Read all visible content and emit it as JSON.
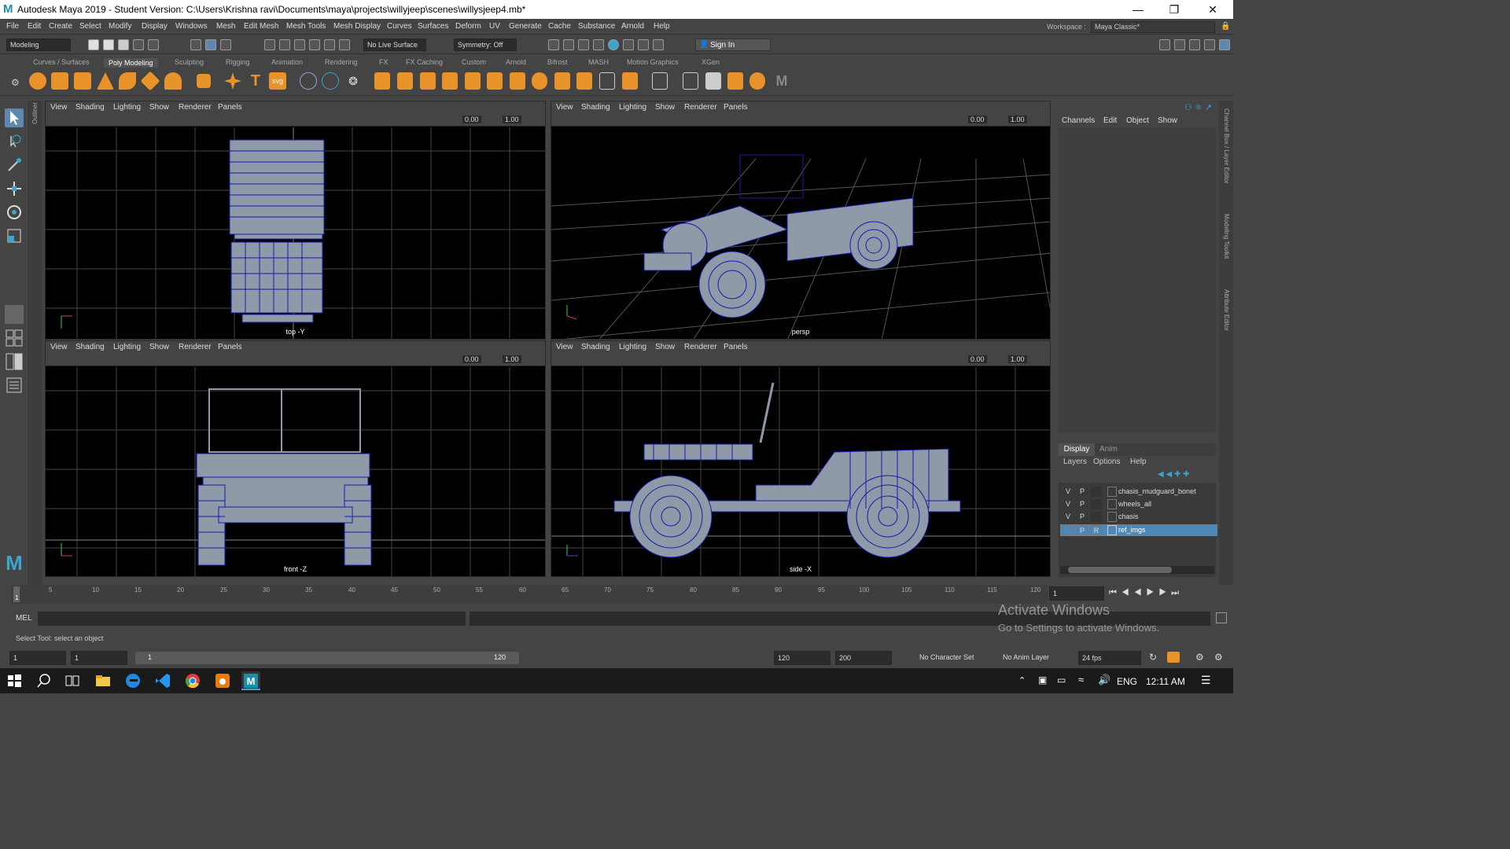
{
  "titlebar": {
    "title": "Autodesk Maya 2019 - Student Version: C:\\Users\\Krishna ravi\\Documents\\maya\\projects\\willyjeep\\scenes\\willysjeep4.mb*",
    "minimize": "—",
    "maximize": "❐",
    "close": "✕"
  },
  "menubar": {
    "items": [
      "File",
      "Edit",
      "Create",
      "Select",
      "Modify",
      "Display",
      "Windows",
      "Mesh",
      "Edit Mesh",
      "Mesh Tools",
      "Mesh Display",
      "Curves",
      "Surfaces",
      "Deform",
      "UV",
      "Generate",
      "Cache",
      "Substance",
      "Arnold",
      "Help"
    ],
    "workspace_label": "Workspace :",
    "workspace_value": "Maya Classic*"
  },
  "statusline": {
    "menuset": "Modeling",
    "live_surface": "No Live Surface",
    "symmetry": "Symmetry: Off",
    "sign_in": "Sign In"
  },
  "shelf": {
    "tabs": [
      "Curves / Surfaces",
      "Poly Modeling",
      "Sculpting",
      "Rigging",
      "Animation",
      "Rendering",
      "FX",
      "FX Caching",
      "Custom",
      "Arnold",
      "Bifrost",
      "MASH",
      "Motion Graphics",
      "XGen"
    ],
    "active_tab": "Poly Modeling",
    "svg_label": "svg",
    "type_label": "T",
    "maya_m": "M"
  },
  "panel_menu": [
    "View",
    "Shading",
    "Lighting",
    "Show",
    "Renderer",
    "Panels"
  ],
  "viewports": [
    {
      "camera": "top -Y",
      "exposure": "0.00",
      "gamma": "1.00"
    },
    {
      "camera": "persp",
      "exposure": "0.00",
      "gamma": "1.00"
    },
    {
      "camera": "front -Z",
      "exposure": "0.00",
      "gamma": "1.00"
    },
    {
      "camera": "side -X",
      "exposure": "0.00",
      "gamma": "1.00"
    }
  ],
  "outliner_tab": "Outliner",
  "channel_box": {
    "menu": [
      "Channels",
      "Edit",
      "Object",
      "Show"
    ],
    "side_tabs": [
      "Channel Box / Layer Editor",
      "Modeling Toolkit",
      "Attribute Editor"
    ]
  },
  "layer_editor": {
    "tabs": [
      "Display",
      "Anim"
    ],
    "menu": [
      "Layers",
      "Options",
      "Help"
    ],
    "layers": [
      {
        "v": "V",
        "p": "P",
        "r": "",
        "name": "chasis_mudguard_bonet",
        "selected": false
      },
      {
        "v": "V",
        "p": "P",
        "r": "",
        "name": "wheels_all",
        "selected": false
      },
      {
        "v": "V",
        "p": "P",
        "r": "",
        "name": "chasis",
        "selected": false
      },
      {
        "v": "",
        "p": "P",
        "r": "R",
        "name": "ref_imgs",
        "selected": true
      }
    ]
  },
  "timeslider": {
    "ticks": [
      "1",
      "5",
      "10",
      "15",
      "20",
      "25",
      "30",
      "35",
      "40",
      "45",
      "50",
      "55",
      "60",
      "65",
      "70",
      "75",
      "80",
      "85",
      "90",
      "95",
      "100",
      "105",
      "110",
      "115",
      "120"
    ],
    "current_frame": "1"
  },
  "cmdline": {
    "label": "MEL"
  },
  "helpline": {
    "text": "Select Tool: select an object"
  },
  "rangeslider": {
    "start": "1",
    "playback_start": "1",
    "range_start": "1",
    "range_end": "120",
    "playback_end": "120",
    "end": "200",
    "character_set": "No Character Set",
    "anim_layer": "No Anim Layer",
    "fps": "24 fps"
  },
  "activate": {
    "line1": "Activate Windows",
    "line2": "Go to Settings to activate Windows."
  },
  "taskbar": {
    "lang": "ENG",
    "time": "12:11 AM"
  },
  "colors": {
    "accent": "#4b9fc7",
    "wire": "#1a1aa8",
    "mesh_fill": "#8e9aa8",
    "shelf_orange": "#e8922a",
    "selected_row": "#4e88b8"
  }
}
